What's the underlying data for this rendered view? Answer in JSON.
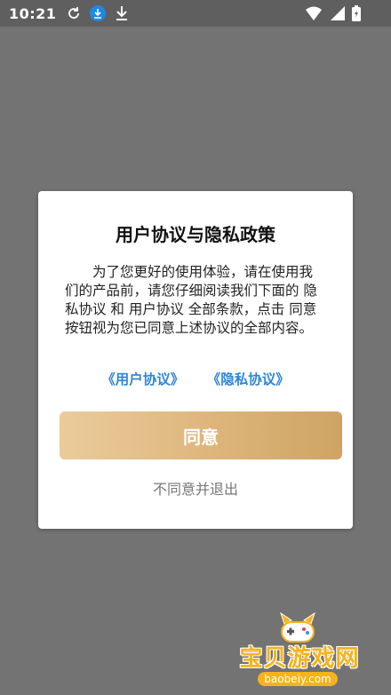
{
  "status_bar": {
    "time": "10:21",
    "icons": [
      "sync-icon",
      "download-badge-icon",
      "download-icon",
      "wifi-icon",
      "signal-icon",
      "battery-icon"
    ]
  },
  "dialog": {
    "title": "用户协议与隐私政策",
    "body": "为了您更好的使用体验，请在使用我们的产品前，请您仔细阅读我们下面的 隐私协议 和 用户协议 全部条款，点击 同意 按钮视为您已同意上述协议的全部内容。",
    "link_user": "《用户协议》",
    "link_privacy": "《隐私协议》",
    "agree_label": "同意",
    "decline_label": "不同意并退出"
  },
  "watermark": {
    "text": "宝贝游戏网",
    "url": "baobeiy.com"
  },
  "colors": {
    "overlay": "#737373",
    "link": "#2f86d6",
    "button_gradient_start": "#ebcb9c",
    "button_gradient_end": "#cfa463",
    "watermark": "#f5b31b"
  }
}
